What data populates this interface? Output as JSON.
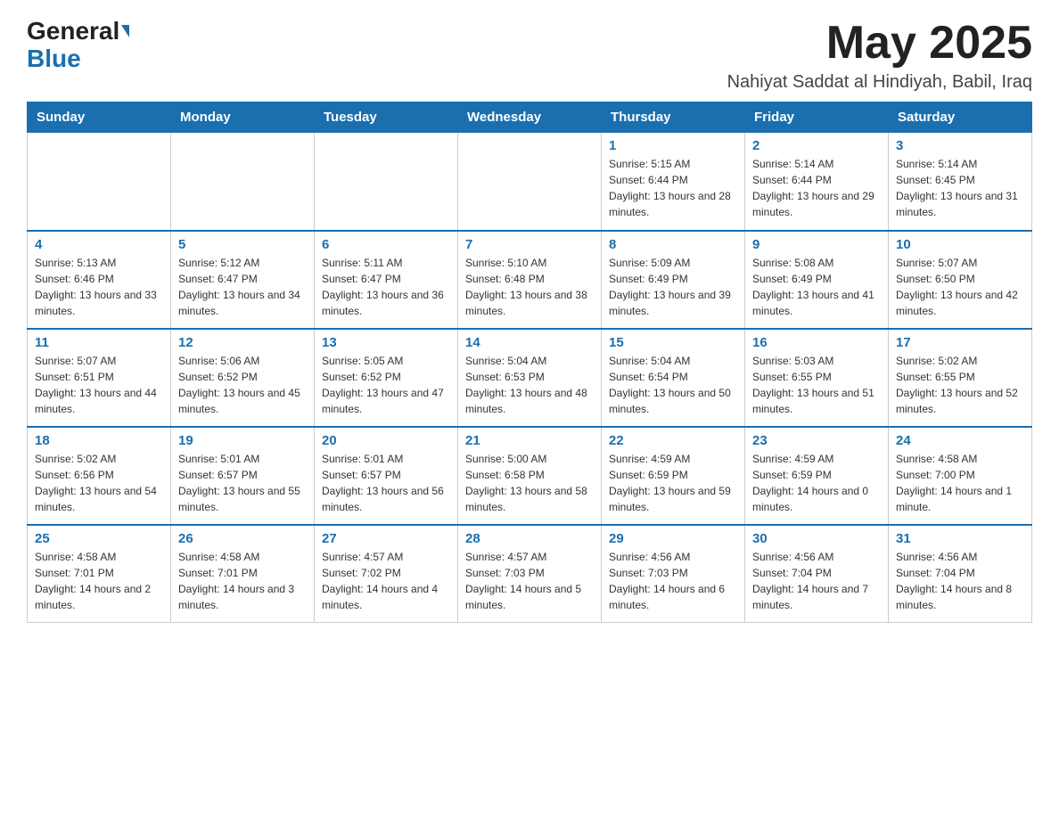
{
  "header": {
    "logo_general": "General",
    "logo_blue": "Blue",
    "title": "May 2025",
    "subtitle": "Nahiyat Saddat al Hindiyah, Babil, Iraq"
  },
  "weekdays": [
    "Sunday",
    "Monday",
    "Tuesday",
    "Wednesday",
    "Thursday",
    "Friday",
    "Saturday"
  ],
  "weeks": [
    {
      "days": [
        {
          "number": "",
          "info": ""
        },
        {
          "number": "",
          "info": ""
        },
        {
          "number": "",
          "info": ""
        },
        {
          "number": "",
          "info": ""
        },
        {
          "number": "1",
          "info": "Sunrise: 5:15 AM\nSunset: 6:44 PM\nDaylight: 13 hours and 28 minutes."
        },
        {
          "number": "2",
          "info": "Sunrise: 5:14 AM\nSunset: 6:44 PM\nDaylight: 13 hours and 29 minutes."
        },
        {
          "number": "3",
          "info": "Sunrise: 5:14 AM\nSunset: 6:45 PM\nDaylight: 13 hours and 31 minutes."
        }
      ]
    },
    {
      "days": [
        {
          "number": "4",
          "info": "Sunrise: 5:13 AM\nSunset: 6:46 PM\nDaylight: 13 hours and 33 minutes."
        },
        {
          "number": "5",
          "info": "Sunrise: 5:12 AM\nSunset: 6:47 PM\nDaylight: 13 hours and 34 minutes."
        },
        {
          "number": "6",
          "info": "Sunrise: 5:11 AM\nSunset: 6:47 PM\nDaylight: 13 hours and 36 minutes."
        },
        {
          "number": "7",
          "info": "Sunrise: 5:10 AM\nSunset: 6:48 PM\nDaylight: 13 hours and 38 minutes."
        },
        {
          "number": "8",
          "info": "Sunrise: 5:09 AM\nSunset: 6:49 PM\nDaylight: 13 hours and 39 minutes."
        },
        {
          "number": "9",
          "info": "Sunrise: 5:08 AM\nSunset: 6:49 PM\nDaylight: 13 hours and 41 minutes."
        },
        {
          "number": "10",
          "info": "Sunrise: 5:07 AM\nSunset: 6:50 PM\nDaylight: 13 hours and 42 minutes."
        }
      ]
    },
    {
      "days": [
        {
          "number": "11",
          "info": "Sunrise: 5:07 AM\nSunset: 6:51 PM\nDaylight: 13 hours and 44 minutes."
        },
        {
          "number": "12",
          "info": "Sunrise: 5:06 AM\nSunset: 6:52 PM\nDaylight: 13 hours and 45 minutes."
        },
        {
          "number": "13",
          "info": "Sunrise: 5:05 AM\nSunset: 6:52 PM\nDaylight: 13 hours and 47 minutes."
        },
        {
          "number": "14",
          "info": "Sunrise: 5:04 AM\nSunset: 6:53 PM\nDaylight: 13 hours and 48 minutes."
        },
        {
          "number": "15",
          "info": "Sunrise: 5:04 AM\nSunset: 6:54 PM\nDaylight: 13 hours and 50 minutes."
        },
        {
          "number": "16",
          "info": "Sunrise: 5:03 AM\nSunset: 6:55 PM\nDaylight: 13 hours and 51 minutes."
        },
        {
          "number": "17",
          "info": "Sunrise: 5:02 AM\nSunset: 6:55 PM\nDaylight: 13 hours and 52 minutes."
        }
      ]
    },
    {
      "days": [
        {
          "number": "18",
          "info": "Sunrise: 5:02 AM\nSunset: 6:56 PM\nDaylight: 13 hours and 54 minutes."
        },
        {
          "number": "19",
          "info": "Sunrise: 5:01 AM\nSunset: 6:57 PM\nDaylight: 13 hours and 55 minutes."
        },
        {
          "number": "20",
          "info": "Sunrise: 5:01 AM\nSunset: 6:57 PM\nDaylight: 13 hours and 56 minutes."
        },
        {
          "number": "21",
          "info": "Sunrise: 5:00 AM\nSunset: 6:58 PM\nDaylight: 13 hours and 58 minutes."
        },
        {
          "number": "22",
          "info": "Sunrise: 4:59 AM\nSunset: 6:59 PM\nDaylight: 13 hours and 59 minutes."
        },
        {
          "number": "23",
          "info": "Sunrise: 4:59 AM\nSunset: 6:59 PM\nDaylight: 14 hours and 0 minutes."
        },
        {
          "number": "24",
          "info": "Sunrise: 4:58 AM\nSunset: 7:00 PM\nDaylight: 14 hours and 1 minute."
        }
      ]
    },
    {
      "days": [
        {
          "number": "25",
          "info": "Sunrise: 4:58 AM\nSunset: 7:01 PM\nDaylight: 14 hours and 2 minutes."
        },
        {
          "number": "26",
          "info": "Sunrise: 4:58 AM\nSunset: 7:01 PM\nDaylight: 14 hours and 3 minutes."
        },
        {
          "number": "27",
          "info": "Sunrise: 4:57 AM\nSunset: 7:02 PM\nDaylight: 14 hours and 4 minutes."
        },
        {
          "number": "28",
          "info": "Sunrise: 4:57 AM\nSunset: 7:03 PM\nDaylight: 14 hours and 5 minutes."
        },
        {
          "number": "29",
          "info": "Sunrise: 4:56 AM\nSunset: 7:03 PM\nDaylight: 14 hours and 6 minutes."
        },
        {
          "number": "30",
          "info": "Sunrise: 4:56 AM\nSunset: 7:04 PM\nDaylight: 14 hours and 7 minutes."
        },
        {
          "number": "31",
          "info": "Sunrise: 4:56 AM\nSunset: 7:04 PM\nDaylight: 14 hours and 8 minutes."
        }
      ]
    }
  ]
}
